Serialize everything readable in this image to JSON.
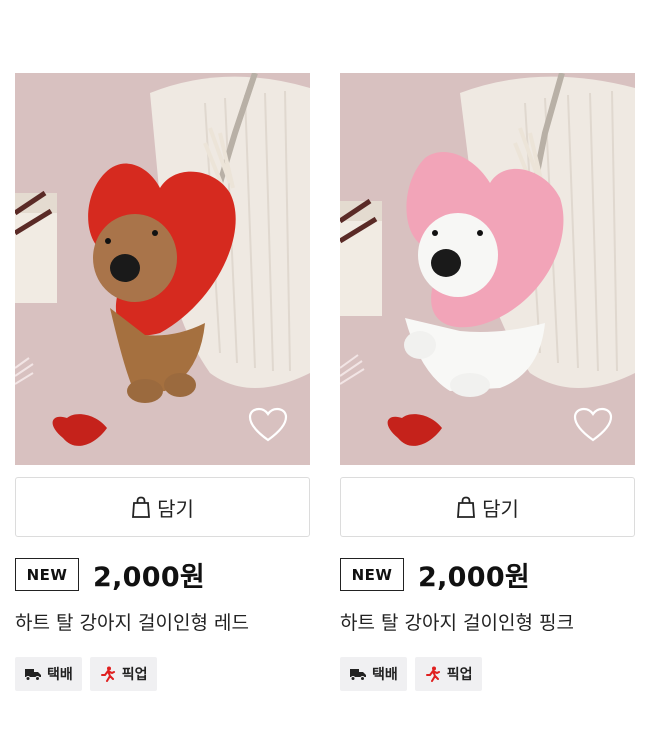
{
  "products": [
    {
      "cart_label": "담기",
      "badge": "NEW",
      "price": "2,000원",
      "title": "하트 탈 강아지 걸이인형 레드",
      "tags": [
        {
          "icon": "delivery-truck-icon",
          "label": "택배"
        },
        {
          "icon": "walking-person-icon",
          "label": "픽업"
        }
      ],
      "heart_color": "#d9261c",
      "dog_color": "#a9744a"
    },
    {
      "cart_label": "담기",
      "badge": "NEW",
      "price": "2,000원",
      "title": "하트 탈 강아지 걸이인형 핑크",
      "tags": [
        {
          "icon": "delivery-truck-icon",
          "label": "택배"
        },
        {
          "icon": "walking-person-icon",
          "label": "픽업"
        }
      ],
      "heart_color": "#f2a4b8",
      "dog_color": "#f6f6f4"
    }
  ]
}
